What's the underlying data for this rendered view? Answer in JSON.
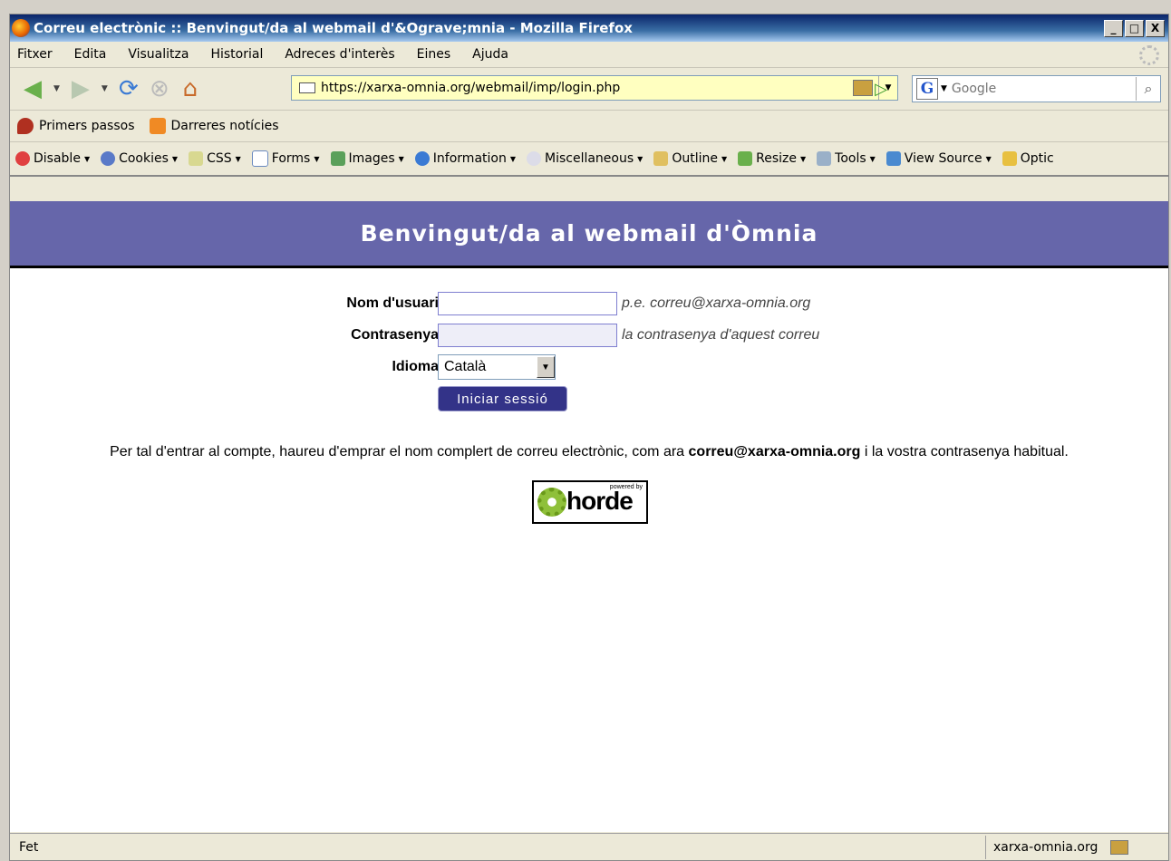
{
  "window": {
    "title": "Correu electrònic :: Benvingut/da al webmail d'&Ograve;mnia - Mozilla Firefox",
    "minimize": "_",
    "maximize": "□",
    "close": "X"
  },
  "menu": [
    "Fitxer",
    "Edita",
    "Visualitza",
    "Historial",
    "Adreces d'interès",
    "Eines",
    "Ajuda"
  ],
  "navigation": {
    "url": "https://xarxa-omnia.org/webmail/imp/login.php",
    "search_placeholder": "Google"
  },
  "bookmarks": [
    "Primers passos",
    "Darreres notícies"
  ],
  "webdev_toolbar": [
    "Disable",
    "Cookies",
    "CSS",
    "Forms",
    "Images",
    "Information",
    "Miscellaneous",
    "Outline",
    "Resize",
    "Tools",
    "View Source",
    "Optic"
  ],
  "page": {
    "header": "Benvingut/da al webmail d'Òmnia",
    "login": {
      "username_label": "Nom d'usuari",
      "username_hint": "p.e. correu@xarxa-omnia.org",
      "password_label": "Contrasenya",
      "password_hint": "la contrasenya d'aquest correu",
      "language_label": "Idioma",
      "language_value": "Català",
      "submit_label": "Iniciar sessió"
    },
    "info": {
      "before": "Per tal d'entrar al compte, haureu d'emprar el nom complert de correu electrònic, com ara ",
      "email": "correu@xarxa-omnia.org",
      "after": " i la vostra contrasenya habitual."
    },
    "powered_by": {
      "small": "powered by",
      "brand": "horde"
    }
  },
  "status": {
    "text": "Fet",
    "domain": "xarxa-omnia.org"
  },
  "colors": {
    "banner": "#6666aa",
    "button": "#333388"
  }
}
